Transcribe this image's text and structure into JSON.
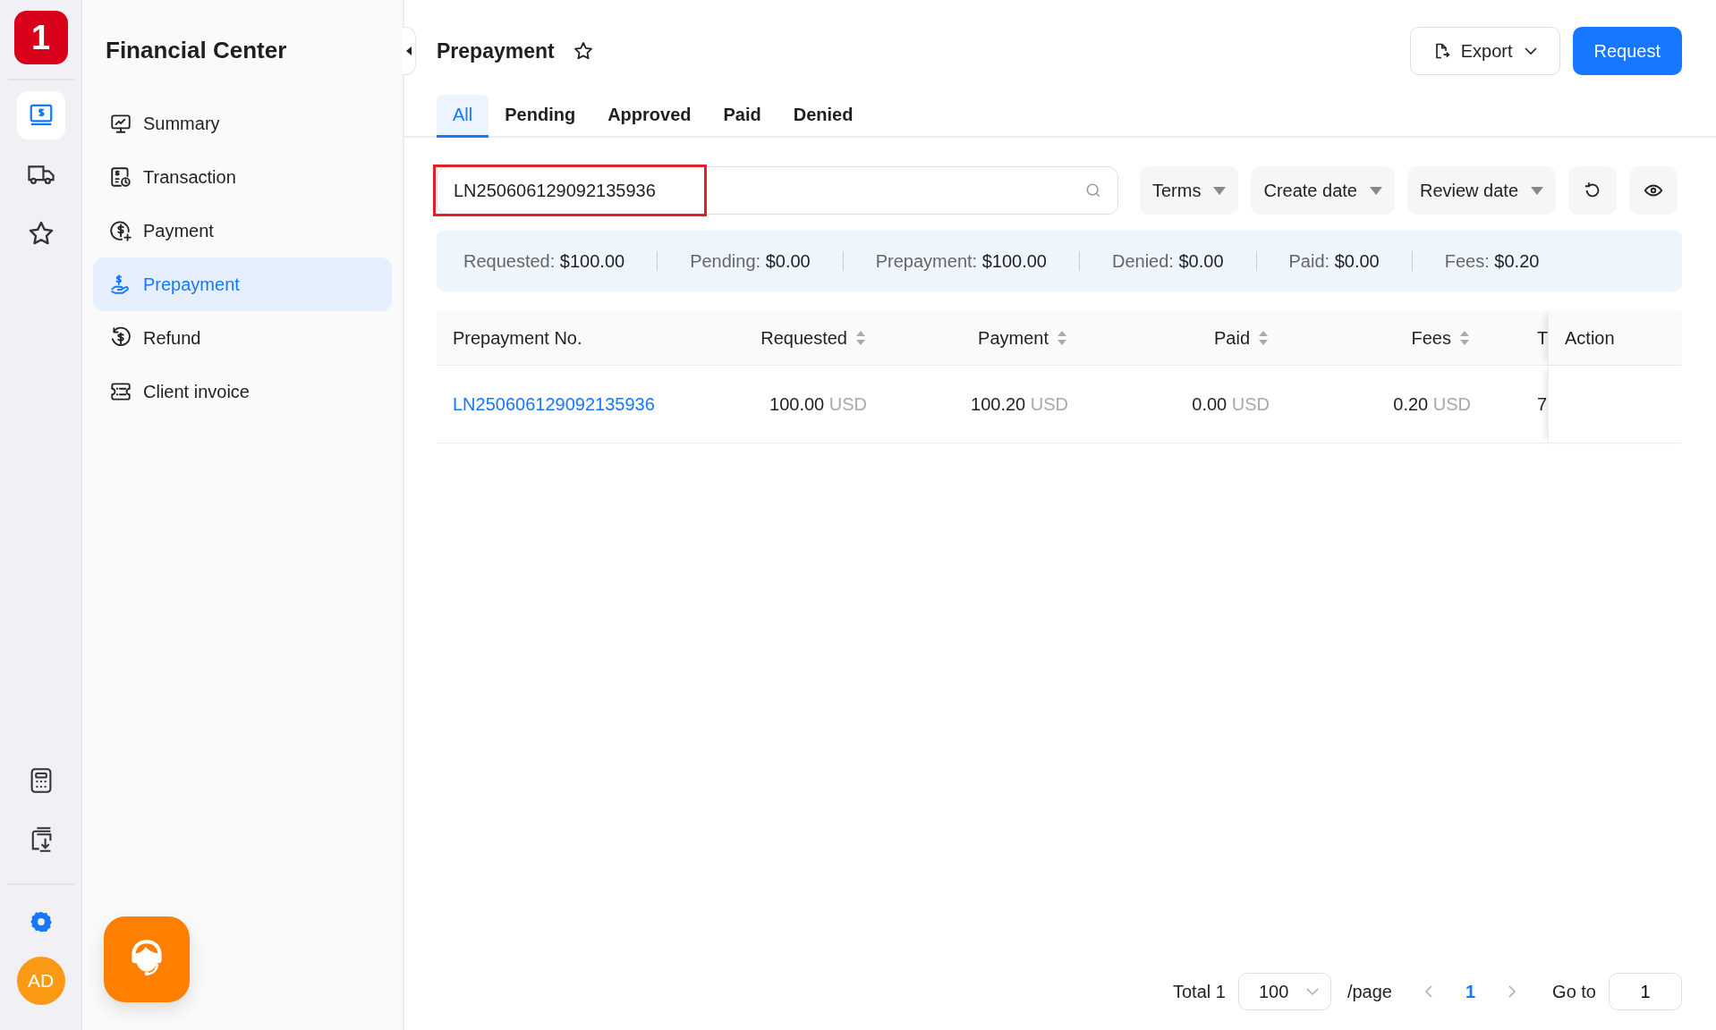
{
  "rail": {
    "logo": "1",
    "items": [
      {
        "kind": "finance",
        "selected": true
      },
      {
        "kind": "truck",
        "selected": false
      },
      {
        "kind": "star",
        "selected": false
      }
    ],
    "bottom_items": [
      {
        "kind": "calculator"
      },
      {
        "kind": "download"
      }
    ],
    "avatar": "AD"
  },
  "sidebar": {
    "title": "Financial Center",
    "items": [
      {
        "label": "Summary",
        "kind": "summary",
        "selected": false
      },
      {
        "label": "Transaction",
        "kind": "transaction",
        "selected": false
      },
      {
        "label": "Payment",
        "kind": "payment",
        "selected": false
      },
      {
        "label": "Prepayment",
        "kind": "prepayment",
        "selected": true
      },
      {
        "label": "Refund",
        "kind": "refund",
        "selected": false
      },
      {
        "label": "Client invoice",
        "kind": "invoice",
        "selected": false
      }
    ]
  },
  "header": {
    "title": "Prepayment",
    "export_label": "Export",
    "request_label": "Request"
  },
  "tabs": [
    {
      "label": "All",
      "selected": true
    },
    {
      "label": "Pending",
      "selected": false
    },
    {
      "label": "Approved",
      "selected": false
    },
    {
      "label": "Paid",
      "selected": false
    },
    {
      "label": "Denied",
      "selected": false
    }
  ],
  "search": {
    "value": "LN250606129092135936",
    "highlighted": true
  },
  "filters": [
    "Terms",
    "Create date",
    "Review date"
  ],
  "summary": [
    {
      "label": "Requested:",
      "value": "$100.00"
    },
    {
      "label": "Pending:",
      "value": "$0.00"
    },
    {
      "label": "Prepayment:",
      "value": "$100.00"
    },
    {
      "label": "Denied:",
      "value": "$0.00"
    },
    {
      "label": "Paid:",
      "value": "$0.00"
    },
    {
      "label": "Fees:",
      "value": "$0.20"
    }
  ],
  "table": {
    "columns": [
      {
        "label": "Prepayment No.",
        "sortable": false
      },
      {
        "label": "Requested",
        "sortable": true
      },
      {
        "label": "Payment",
        "sortable": true
      },
      {
        "label": "Paid",
        "sortable": true
      },
      {
        "label": "Fees",
        "sortable": true
      },
      {
        "label": "T"
      },
      {
        "label": "Action",
        "sortable": false
      }
    ],
    "rows": [
      {
        "number": "LN250606129092135936",
        "amounts": [
          {
            "value": "100.00",
            "currency": "USD"
          },
          {
            "value": "100.20",
            "currency": "USD"
          },
          {
            "value": "0.00",
            "currency": "USD"
          },
          {
            "value": "0.20",
            "currency": "USD"
          }
        ],
        "column_6": "7"
      }
    ]
  },
  "pagination": {
    "total": "Total 1",
    "page_size": "100",
    "per_page": "/page",
    "pages": [
      {
        "label": "1",
        "selected": true
      }
    ],
    "goto_label": "Go to",
    "goto_value": "1"
  }
}
